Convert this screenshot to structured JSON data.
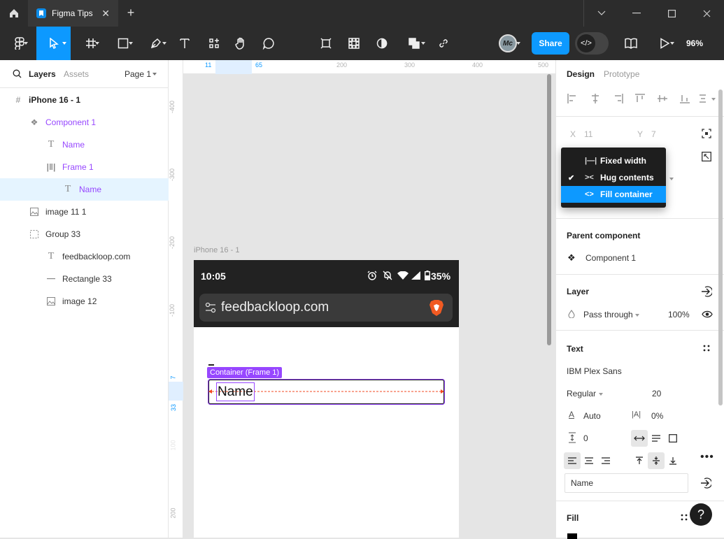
{
  "titlebar": {
    "tab_title": "Figma Tips",
    "icons": [
      "home-icon",
      "figma-file-icon",
      "close-icon",
      "plus-icon",
      "chevron-down-icon",
      "minimize-icon",
      "maximize-icon",
      "window-close-icon"
    ]
  },
  "toolbar": {
    "share_label": "Share",
    "devmode_label": "</>",
    "zoom_label": "96%"
  },
  "left_panel": {
    "tabs": [
      "Layers",
      "Assets"
    ],
    "page_label": "Page 1",
    "layers": [
      {
        "label": "iPhone 16 - 1",
        "icon": "frame-icon"
      },
      {
        "label": "Component 1",
        "icon": "component-icon"
      },
      {
        "label": "Name",
        "icon": "text-icon"
      },
      {
        "label": "Frame 1",
        "icon": "auto-layout-icon"
      },
      {
        "label": "Name",
        "icon": "text-icon"
      },
      {
        "label": "image 11 1",
        "icon": "image-icon"
      },
      {
        "label": "Group 33",
        "icon": "group-icon"
      },
      {
        "label": "feedbackloop.com",
        "icon": "text-icon"
      },
      {
        "label": "Rectangle 33",
        "icon": "line-icon"
      },
      {
        "label": "image 12",
        "icon": "image-icon"
      }
    ]
  },
  "rulers": {
    "h_labels": [
      "11",
      "65",
      "200",
      "300",
      "400",
      "500"
    ],
    "v_labels": [
      "-400",
      "-300",
      "-200",
      "-100",
      "7",
      "33",
      "100",
      "200"
    ]
  },
  "canvas": {
    "frame_label": "iPhone 16 - 1",
    "time": "10:05",
    "battery": "35%",
    "url": "feedbackloop.com",
    "selection_label": "Container (Frame 1)",
    "name_text": "Name"
  },
  "right_panel": {
    "tabs": [
      "Design",
      "Prototype"
    ],
    "x_label": "X",
    "x_value": "11",
    "y_label": "Y",
    "y_value": "7",
    "dropdown": [
      {
        "label": "Fixed width",
        "checked": false,
        "highlighted": false
      },
      {
        "label": "Hug contents",
        "checked": true,
        "highlighted": false
      },
      {
        "label": "Fill container",
        "checked": false,
        "highlighted": true
      }
    ],
    "parent_component_title": "Parent component",
    "parent_component_name": "Component 1",
    "layer_title": "Layer",
    "blend_mode": "Pass through",
    "opacity": "100%",
    "text_title": "Text",
    "font_family": "IBM Plex Sans",
    "font_weight": "Regular",
    "font_size": "20",
    "line_height": "Auto",
    "letter_spacing": "0%",
    "paragraph_spacing": "0",
    "text_content": "Name",
    "fill_title": "Fill",
    "help_label": "?",
    "accent_color": "#0d99ff",
    "component_color": "#9747ff"
  }
}
